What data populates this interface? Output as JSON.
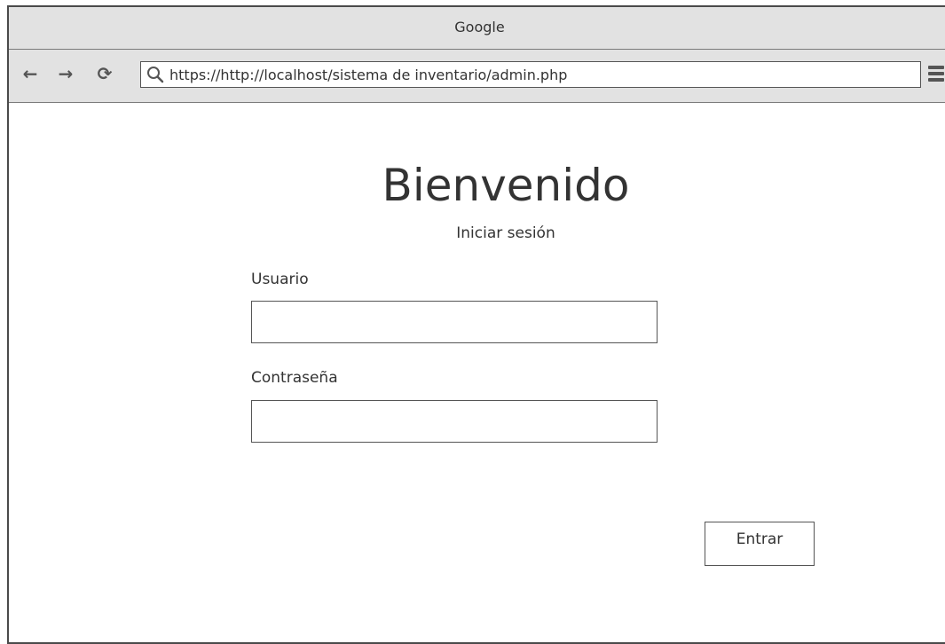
{
  "window": {
    "title": "Google"
  },
  "toolbar": {
    "back_icon": "←",
    "forward_icon": "→",
    "reload_icon": "⟳",
    "url": "https://http://localhost/sistema de inventario/admin.php"
  },
  "login": {
    "title": "Bienvenido",
    "subtitle": "Iniciar sesión",
    "username_label": "Usuario",
    "username_value": "",
    "password_label": "Contraseña",
    "password_value": "",
    "submit_label": "Entrar"
  },
  "colors": {
    "chrome_bg": "#e2e2e2",
    "border": "#4a4a4a",
    "text": "#333333"
  }
}
